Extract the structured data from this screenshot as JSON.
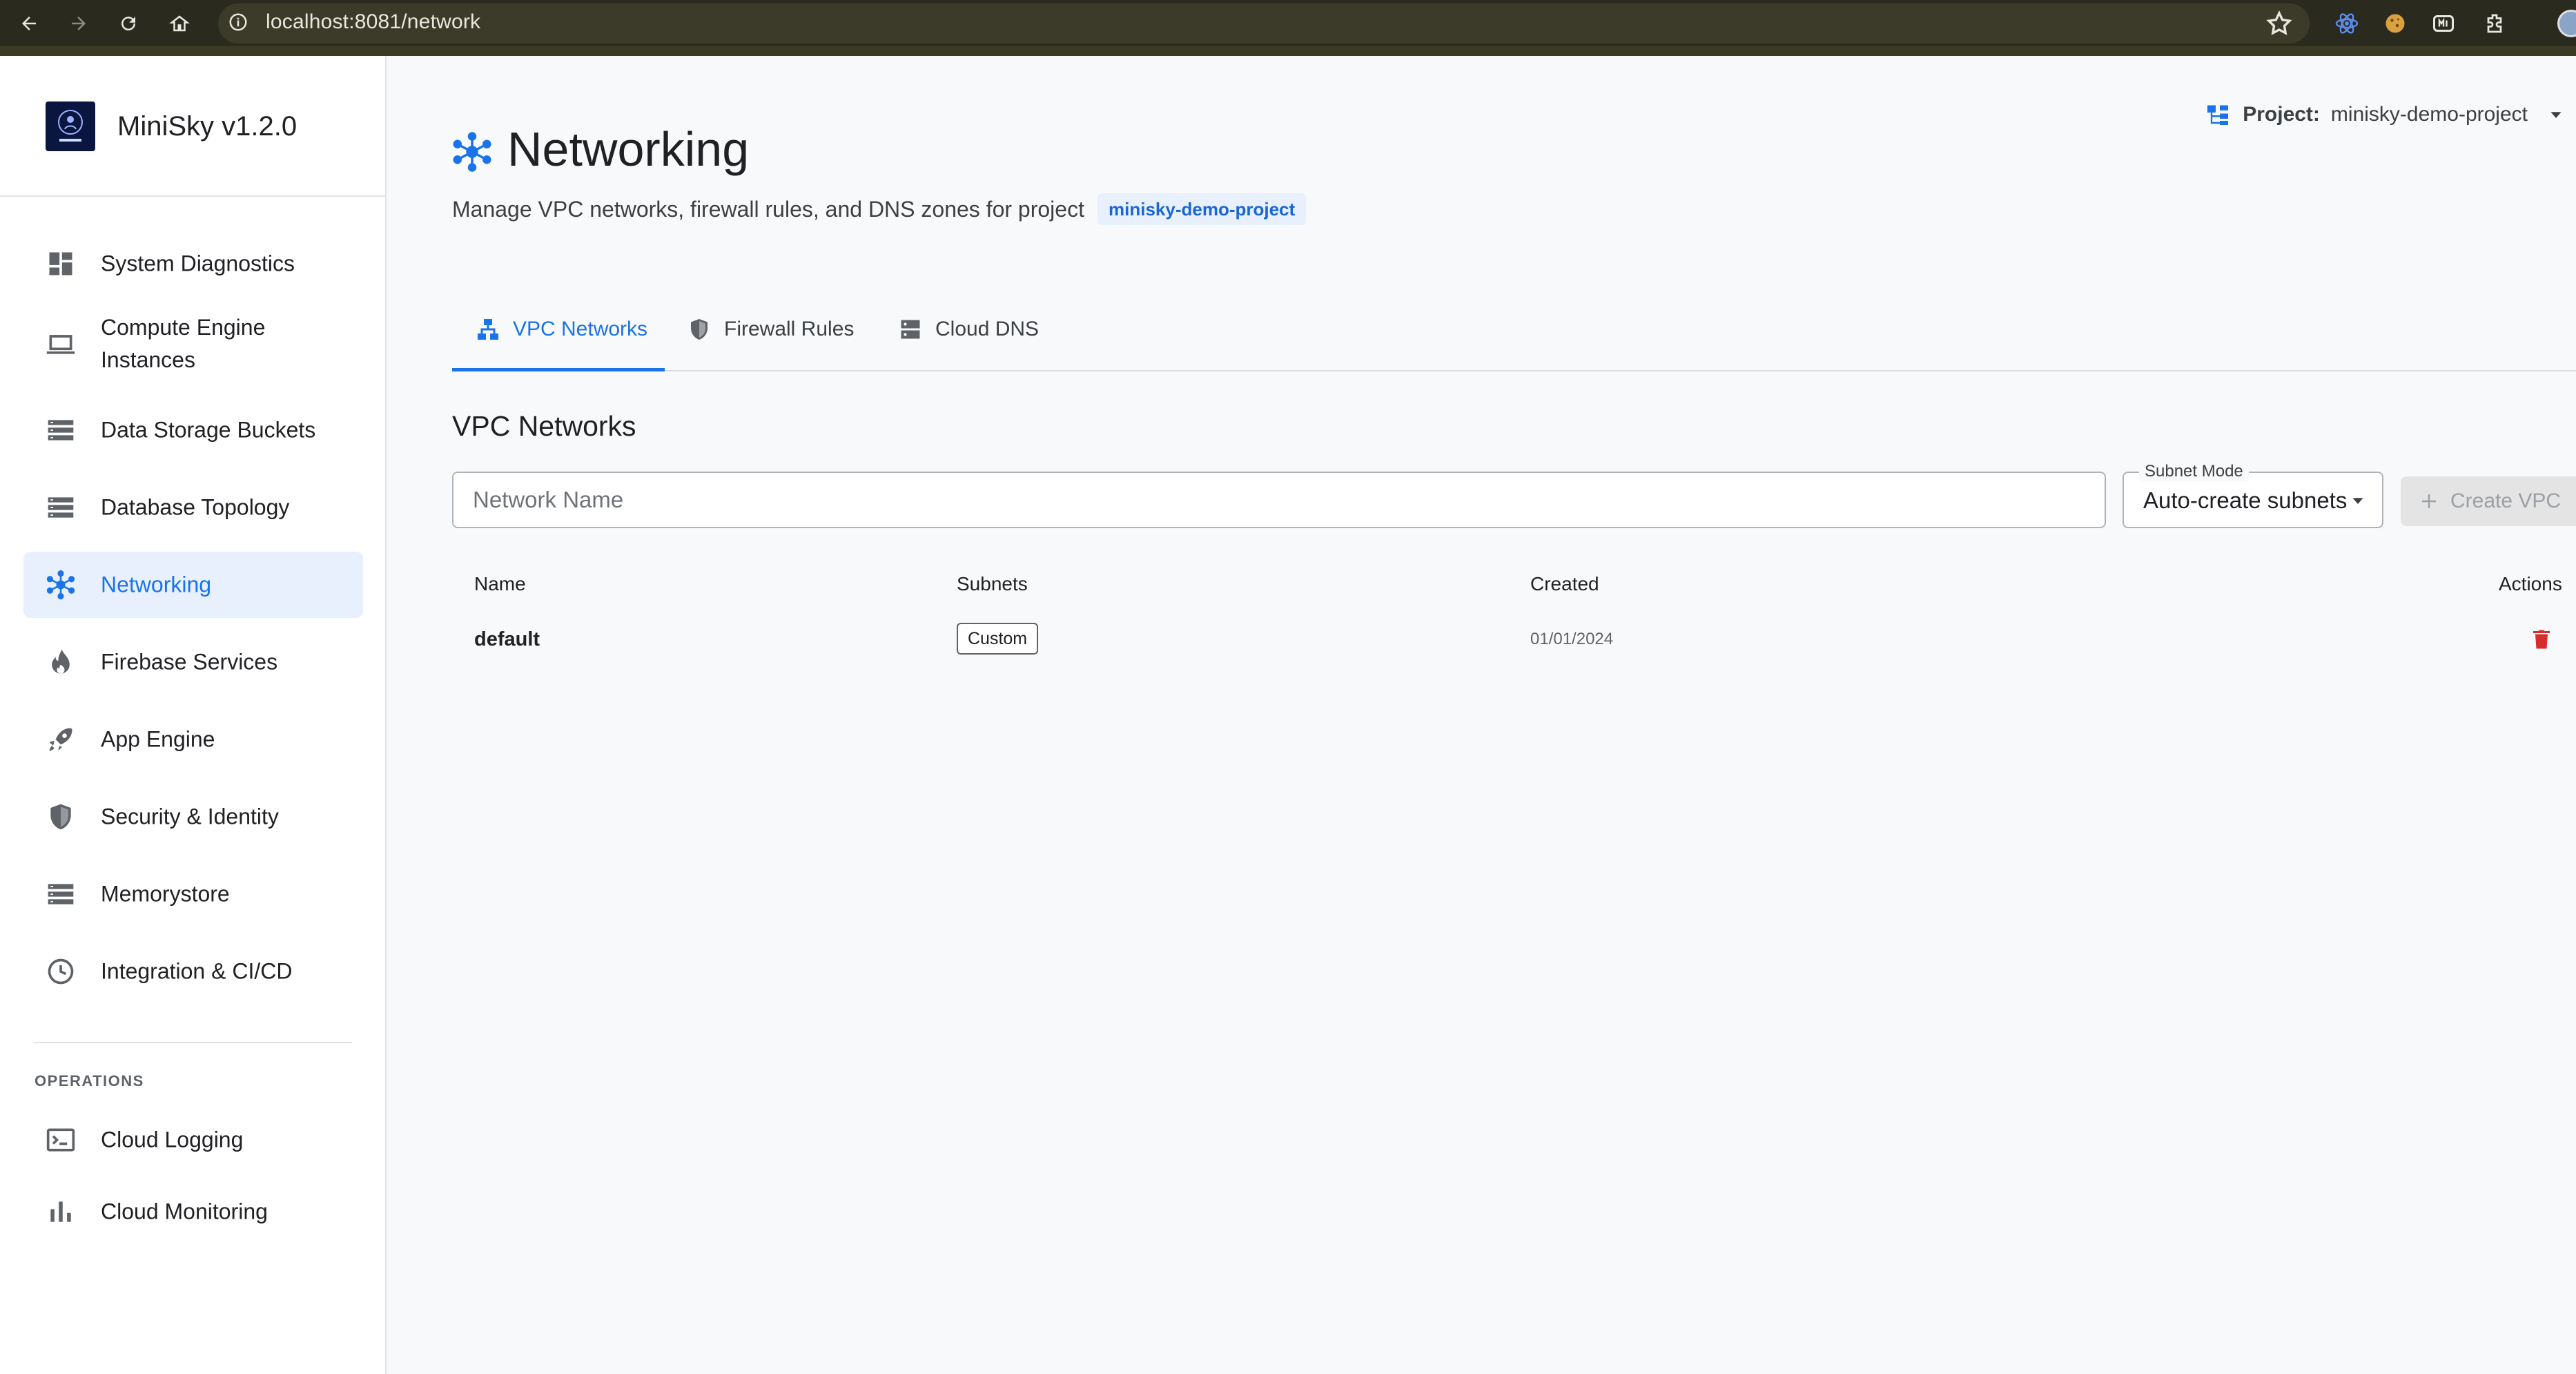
{
  "browser": {
    "url": "localhost:8081/network"
  },
  "sidebar": {
    "brand": "MiniSky v1.2.0",
    "items": [
      {
        "label": "System Diagnostics",
        "icon": "dashboard-icon"
      },
      {
        "label": "Compute Engine Instances",
        "icon": "laptop-icon"
      },
      {
        "label": "Data Storage Buckets",
        "icon": "storage-icon"
      },
      {
        "label": "Database Topology",
        "icon": "database-icon"
      },
      {
        "label": "Networking",
        "icon": "network-hub-icon",
        "active": true
      },
      {
        "label": "Firebase Services",
        "icon": "fire-icon"
      },
      {
        "label": "App Engine",
        "icon": "rocket-icon"
      },
      {
        "label": "Security & Identity",
        "icon": "shield-icon"
      },
      {
        "label": "Memorystore",
        "icon": "memory-icon"
      },
      {
        "label": "Integration & CI/CD",
        "icon": "clock-icon"
      }
    ],
    "section_label": "OPERATIONS",
    "ops_items": [
      {
        "label": "Cloud Logging",
        "icon": "terminal-icon"
      },
      {
        "label": "Cloud Monitoring",
        "icon": "bar-chart-icon"
      }
    ]
  },
  "header": {
    "title": "Networking",
    "description": "Manage VPC networks, firewall rules, and DNS zones for project",
    "project_chip": "minisky-demo-project",
    "project_key": "Project:",
    "project_value": "minisky-demo-project"
  },
  "tabs": [
    {
      "label": "VPC Networks",
      "active": true
    },
    {
      "label": "Firewall Rules"
    },
    {
      "label": "Cloud DNS"
    }
  ],
  "vpc": {
    "section_title": "VPC Networks",
    "name_placeholder": "Network Name",
    "subnet_mode_label": "Subnet Mode",
    "subnet_mode_value": "Auto-create subnets",
    "create_label": "Create VPC",
    "columns": [
      "Name",
      "Subnets",
      "Created",
      "Actions"
    ],
    "rows": [
      {
        "name": "default",
        "subnets": "Custom",
        "created": "01/01/2024"
      }
    ]
  },
  "colors": {
    "accent": "#1a73e8",
    "danger": "#d32f2f",
    "active_bg": "#e8f0fe"
  }
}
